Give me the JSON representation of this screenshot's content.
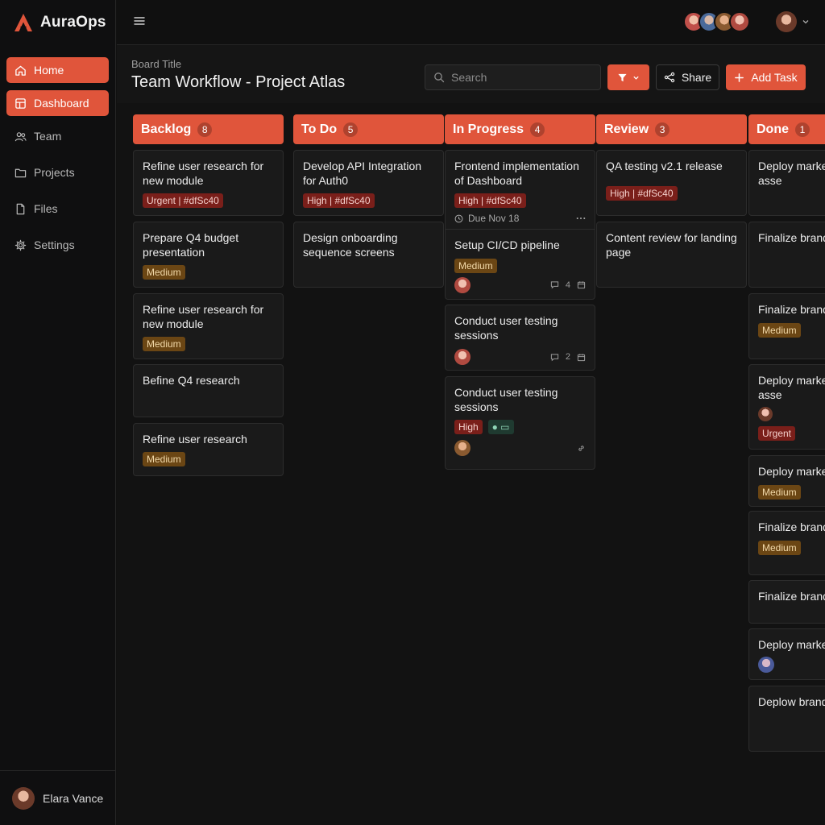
{
  "app": {
    "name": "AuraOps",
    "logo_icon": "aura-logo-icon"
  },
  "sidebar": {
    "items": [
      {
        "label": "Home",
        "icon": "home-icon",
        "active": true
      },
      {
        "label": "Dashboard",
        "icon": "dashboard-icon",
        "active": true
      },
      {
        "label": "Team",
        "icon": "team-icon",
        "active": false
      },
      {
        "label": "Projects",
        "icon": "folder-icon",
        "active": false
      },
      {
        "label": "Files",
        "icon": "file-icon",
        "active": false
      },
      {
        "label": "Settings",
        "icon": "gear-icon",
        "active": false
      }
    ],
    "user": {
      "name": "Elara Vance"
    }
  },
  "header": {
    "subtitle": "Board Title",
    "title": "Team Workflow - Project Atlas",
    "search_placeholder": "Search",
    "share_label": "Share",
    "add_label": "Add Task"
  },
  "columns": [
    {
      "title": "Backlog",
      "count": "8",
      "cards": [
        {
          "title": "Refine user research for new module",
          "badge": "Urgent | #dfSc40"
        },
        {
          "title": "Prepare Q4 budget presentation",
          "badge": "Medium"
        },
        {
          "title": "Refine user research for new module",
          "badge": "Medium"
        },
        {
          "title": "Befine Q4 research"
        },
        {
          "title": "Refine user research",
          "badge": "Medium"
        }
      ]
    },
    {
      "title": "To Do",
      "count": "5",
      "cards": [
        {
          "title": "Develop API Integration for Auth0",
          "badge": "High | #dfSc40"
        },
        {
          "title": "Design onboarding sequence screens"
        }
      ]
    },
    {
      "title": "In Progress",
      "count": "4",
      "cards": [
        {
          "title": "Frontend implementation of Dashboard",
          "badge": "High | #dfSc40",
          "due": "Due Nov 18"
        },
        {
          "title": "Setup CI/CD pipeline",
          "badge": "Medium",
          "comments": "4"
        },
        {
          "title": "Conduct user testing sessions",
          "comments": "2"
        },
        {
          "title": "Conduct user testing sessions",
          "badge": "High"
        }
      ]
    },
    {
      "title": "Review",
      "count": "3",
      "cards": [
        {
          "title": "QA testing v2.1 release",
          "badge": "High | #dfSc40"
        },
        {
          "title": "Content review for landing page"
        }
      ]
    },
    {
      "title": "Done",
      "count": "1",
      "cards": [
        {
          "title": "Deploy marketi campaign asse"
        },
        {
          "title": "Finalize brandi guidelines"
        },
        {
          "title": "Finalize brandi guidelines",
          "badge": "Medium"
        },
        {
          "title": "Deploy marketi campaign asse",
          "badge": "Urgent"
        },
        {
          "title": "Deploy marketi",
          "badge": "Medium"
        },
        {
          "title": "Finalize brandi guidelines",
          "badge": "Medium"
        },
        {
          "title": "Finalize brandi"
        },
        {
          "title": "Deploy marketi"
        },
        {
          "title": "Deplow brandi guidelines"
        }
      ]
    }
  ],
  "colors": {
    "accent": "#e0553b",
    "background": "#111111",
    "card": "#1a1a1a"
  }
}
